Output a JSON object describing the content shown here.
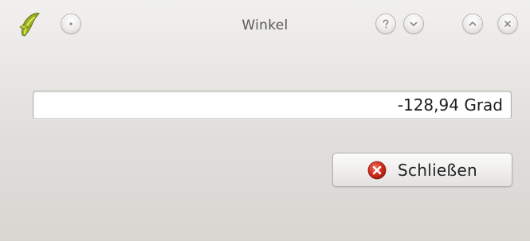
{
  "window": {
    "title": "Winkel"
  },
  "titlebar": {
    "app_icon": "qgis-logo-icon",
    "menu_button_icon": "window-menu-icon",
    "buttons": [
      {
        "name": "help",
        "icon": "question-mark-icon"
      },
      {
        "name": "minimize",
        "icon": "chevron-down-icon"
      },
      {
        "name": "maximize",
        "icon": "chevron-up-icon"
      },
      {
        "name": "close",
        "icon": "close-x-icon"
      }
    ]
  },
  "measurement": {
    "value": "-128,94 Grad"
  },
  "actions": {
    "close_label": "Schließen",
    "close_icon": "red-cancel-icon"
  },
  "colors": {
    "close_icon_red": "#d3301f",
    "window_bg": "#ebe9e7",
    "title_text": "#5a5a5a"
  }
}
